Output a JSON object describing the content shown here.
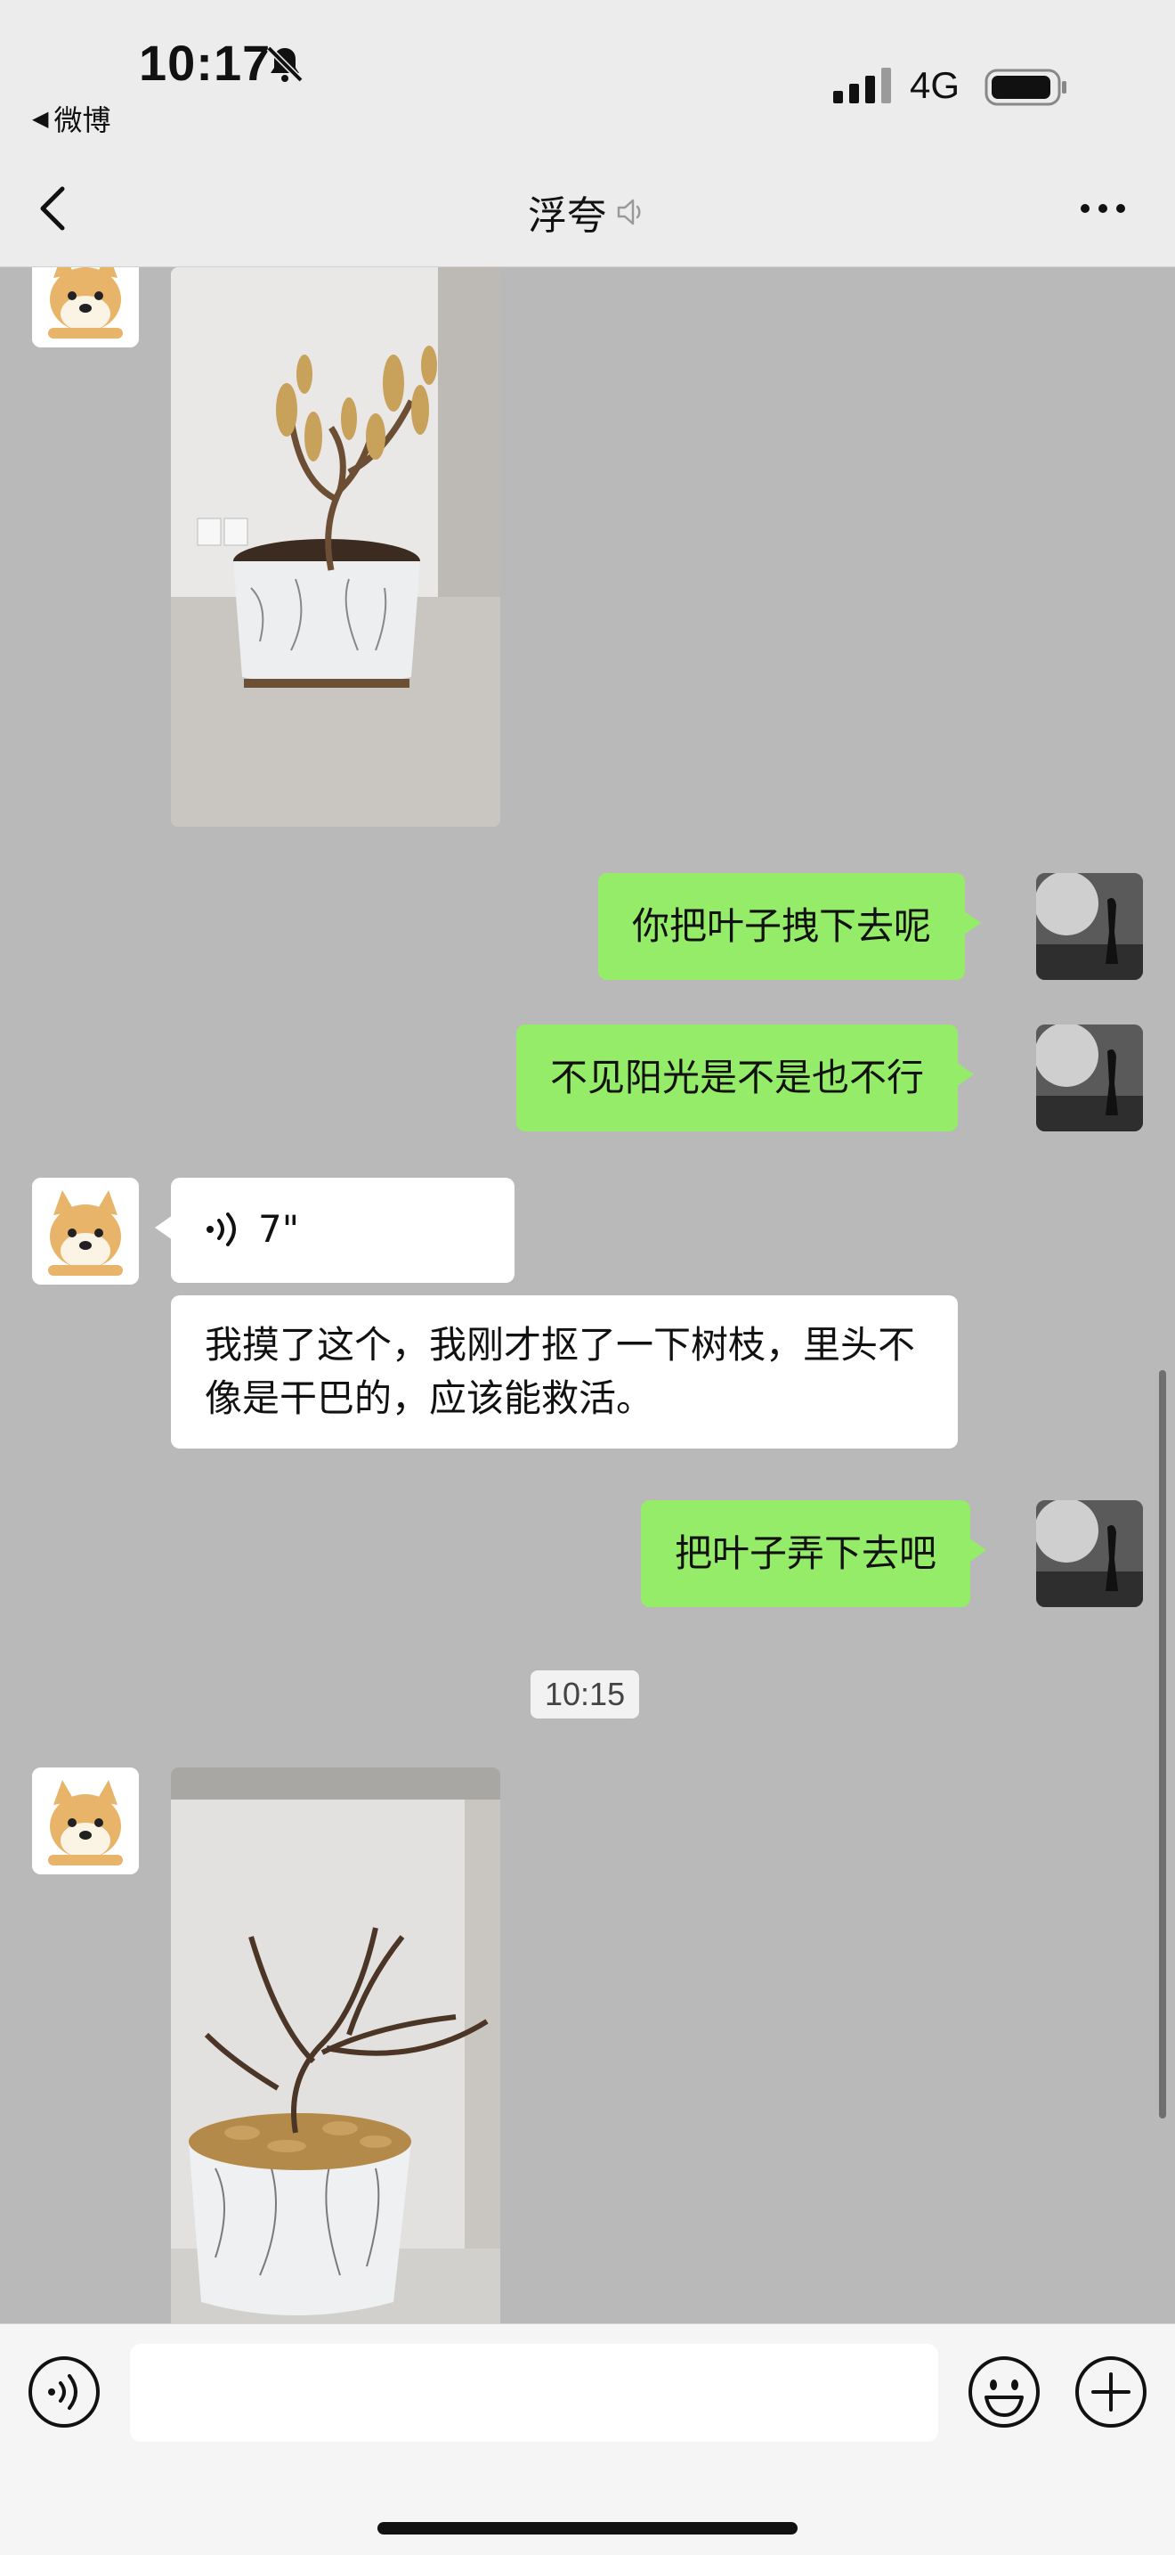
{
  "status_bar": {
    "time": "10:17",
    "back_app": "微博",
    "network": "4G"
  },
  "nav": {
    "title": "浮夸"
  },
  "messages": [
    {
      "type": "image",
      "side": "received",
      "description_icon": "dead-plant-photo"
    },
    {
      "type": "text",
      "side": "sent",
      "text": "你把叶子拽下去呢"
    },
    {
      "type": "text",
      "side": "sent",
      "text": "不见阳光是不是也不行"
    },
    {
      "type": "voice",
      "side": "received",
      "duration": "7\""
    },
    {
      "type": "text",
      "side": "received",
      "text": "我摸了这个，我刚才抠了一下树枝，里头不像是干巴的，应该能救活。"
    },
    {
      "type": "text",
      "side": "sent",
      "text": "把叶子弄下去吧"
    },
    {
      "type": "timestamp",
      "text": "10:15"
    },
    {
      "type": "image",
      "side": "received",
      "description_icon": "bare-plant-photo"
    }
  ],
  "input": {
    "placeholder": ""
  },
  "colors": {
    "sent_bubble": "#95ec69",
    "received_bubble": "#ffffff",
    "chat_background": "#b9b9b9",
    "nav_background": "#ececec"
  },
  "icons": [
    "bell-muted-icon",
    "signal-icon",
    "battery-icon",
    "back-chevron-icon",
    "mute-speaker-icon",
    "more-icon",
    "voice-wave-icon",
    "voice-input-icon",
    "emoji-icon",
    "plus-icon"
  ]
}
